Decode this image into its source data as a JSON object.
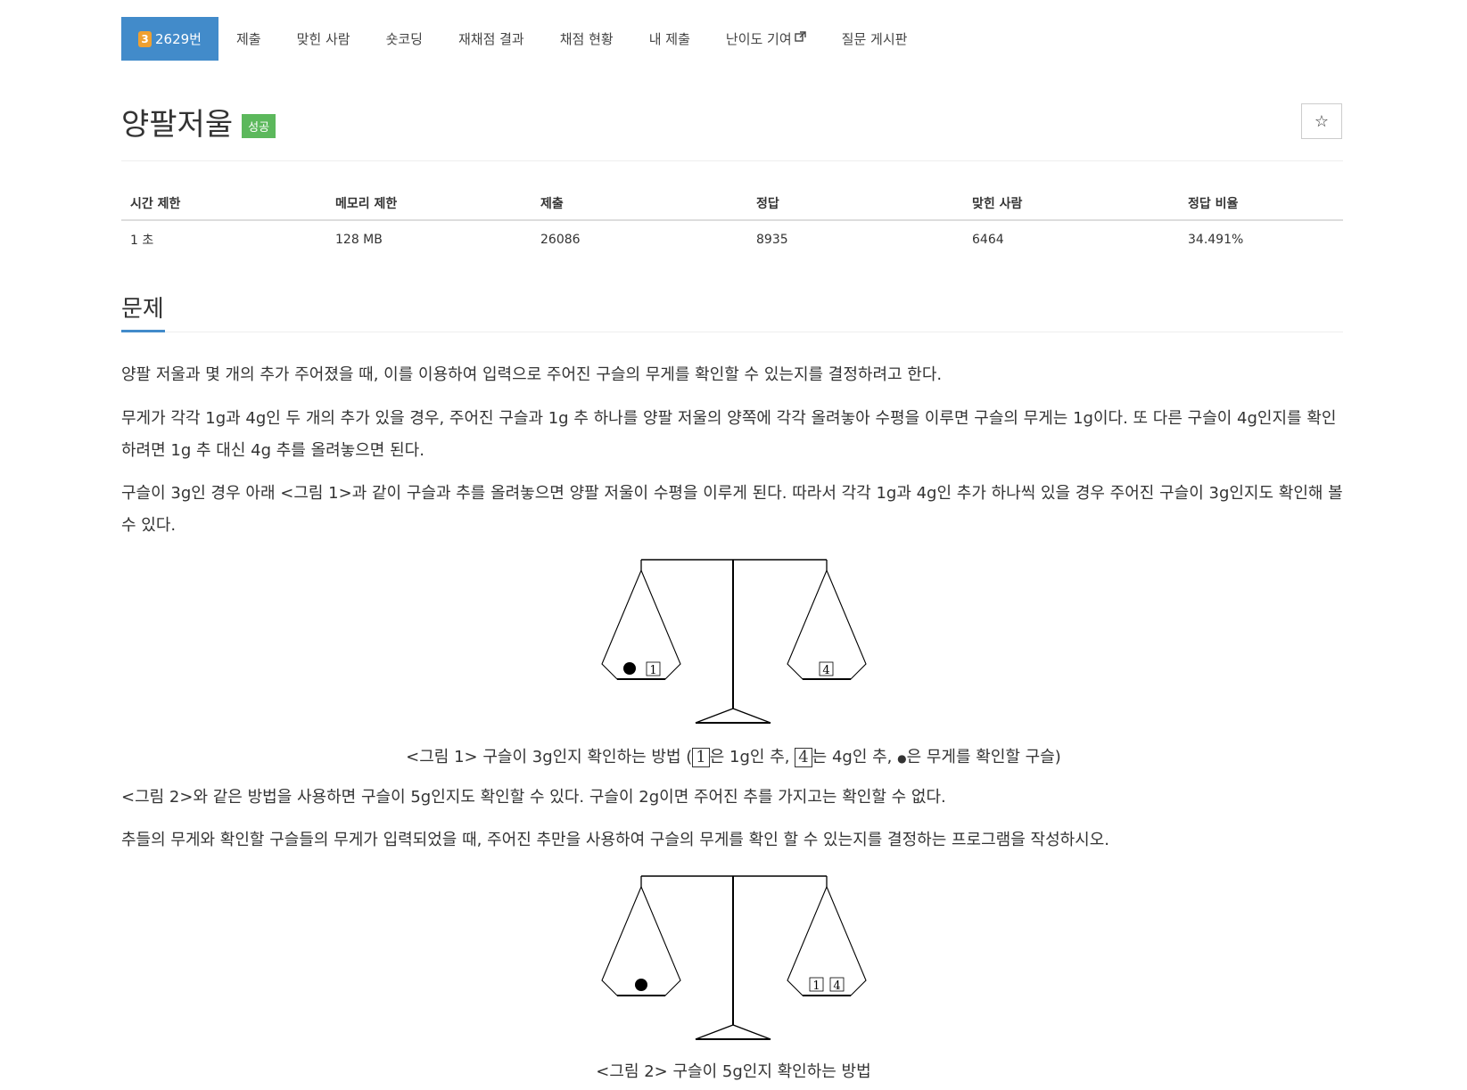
{
  "nav": {
    "tier": "3",
    "problem_number": "2629번",
    "items": [
      "제출",
      "맞힌 사람",
      "숏코딩",
      "재채점 결과",
      "채점 현황",
      "내 제출",
      "난이도 기여",
      "질문 게시판"
    ]
  },
  "problem": {
    "title": "양팔저울",
    "status_badge": "성공",
    "star": "☆"
  },
  "info_table": {
    "headers": [
      "시간 제한",
      "메모리 제한",
      "제출",
      "정답",
      "맞힌 사람",
      "정답 비율"
    ],
    "values": [
      "1 초",
      "128 MB",
      "26086",
      "8935",
      "6464",
      "34.491%"
    ]
  },
  "section": {
    "heading": "문제",
    "p1": "양팔 저울과 몇 개의 추가 주어졌을 때, 이를 이용하여 입력으로 주어진 구슬의 무게를 확인할 수 있는지를 결정하려고 한다.",
    "p2": "무게가 각각 1g과 4g인 두 개의 추가 있을 경우, 주어진 구슬과 1g 추 하나를 양팔 저울의 양쪽에 각각 올려놓아 수평을 이루면 구슬의 무게는 1g이다. 또 다른 구슬이 4g인지를 확인하려면 1g 추 대신 4g 추를 올려놓으면 된다.",
    "p3": "구슬이 3g인 경우 아래 <그림 1>과 같이 구슬과 추를 올려놓으면 양팔 저울이 수평을 이루게 된다. 따라서 각각 1g과 4g인 추가 하나씩 있을 경우 주어진 구슬이 3g인지도 확인해 볼 수 있다.",
    "fig1_caption_pre": "<그림 1> 구슬이 3g인지 확인하는 방법 (",
    "fig1_box1": "1",
    "fig1_caption_mid1": "은 1g인 추, ",
    "fig1_box2": "4",
    "fig1_caption_mid2": "는 4g인 추, ",
    "fig1_dot": "●",
    "fig1_caption_post": "은 무게를 확인할 구슬)",
    "p4": "<그림 2>와 같은 방법을 사용하면 구슬이 5g인지도 확인할 수 있다. 구슬이 2g이면 주어진 추를 가지고는 확인할 수 없다.",
    "p5": "추들의 무게와 확인할 구슬들의 무게가 입력되었을 때, 주어진 추만을 사용하여 구슬의 무게를 확인 할 수 있는지를 결정하는 프로그램을 작성하시오.",
    "fig2_caption": "<그림 2> 구슬이 5g인지 확인하는 방법"
  },
  "figures": {
    "fig1": {
      "left_weights": [
        "1"
      ],
      "right_weights": [
        "4"
      ],
      "marble_on": "left"
    },
    "fig2": {
      "left_weights": [],
      "right_weights": [
        "1",
        "4"
      ],
      "marble_on": "left"
    }
  }
}
